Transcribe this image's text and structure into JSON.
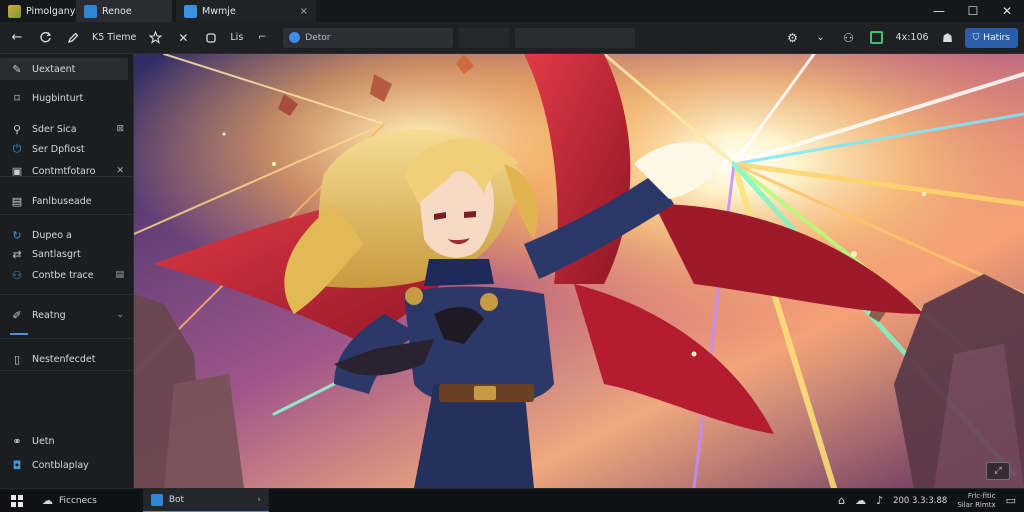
{
  "tabs": [
    {
      "label": "Pimolgany",
      "favicon_color": "#b9852f"
    },
    {
      "label": "Renoe",
      "favicon_color": "#2f86d8"
    },
    {
      "label": "Mwmje",
      "favicon_color": "#3b92e0",
      "close": "×"
    }
  ],
  "window_controls": {
    "minimize": "—",
    "maximize": "☐",
    "close": "✕"
  },
  "toolbar": {
    "back": "←",
    "nav_label": "K5 Tieme",
    "tool_label": "Lis",
    "address": "Detor",
    "zoom": "4x:106",
    "primary_button": "Hatirs"
  },
  "sidebar": {
    "items": [
      {
        "label": "Uextaent",
        "icon": "brush-icon",
        "glyph": "✎"
      },
      {
        "label": "Hugbinturt",
        "icon": "bookmark-icon",
        "glyph": "⌑"
      },
      {
        "label": "Sder Sica",
        "icon": "lock-icon",
        "glyph": "⚲",
        "trail": "⊠"
      },
      {
        "label": "Ser Dpfiost",
        "icon": "power-icon",
        "glyph": "⏻",
        "blue": true
      },
      {
        "label": "Contmtfotaro",
        "icon": "image-icon",
        "glyph": "▣",
        "trail": "✕"
      },
      {
        "label": "Fanlbuseade",
        "icon": "document-icon",
        "glyph": "▤"
      },
      {
        "label": "Dupeo a",
        "icon": "refresh-icon",
        "glyph": "↻",
        "blue": true
      },
      {
        "label": "Santlasgrt",
        "icon": "transfer-icon",
        "glyph": "⇄"
      },
      {
        "label": "Contbe trace",
        "icon": "person-icon",
        "glyph": "⚇",
        "blue": true,
        "trail": "▤"
      },
      {
        "label": "Reatng",
        "icon": "pen-icon",
        "glyph": "✐",
        "trail": "⌄"
      },
      {
        "label": "Nestenfecdet",
        "icon": "panel-icon",
        "glyph": "▯"
      },
      {
        "label": "Uetn",
        "icon": "link-icon",
        "glyph": "⚭"
      },
      {
        "label": "Contblaplay",
        "icon": "display-icon",
        "glyph": "◘",
        "blue": true
      }
    ]
  },
  "taskbar": {
    "search_label": "Ficcnecs",
    "active_app": "Bot",
    "active_arrow": "›",
    "time": "200 3.3:3.88",
    "date_line1": "Frlc-fitic",
    "date_line2": "Silar Rlmtx"
  },
  "artwork": {
    "accent_cape": "#d5283c",
    "hair": "#e8c46a",
    "suit": "#2a3566",
    "sky_top": "#3e3c7a",
    "burst": "#fff6d8"
  }
}
